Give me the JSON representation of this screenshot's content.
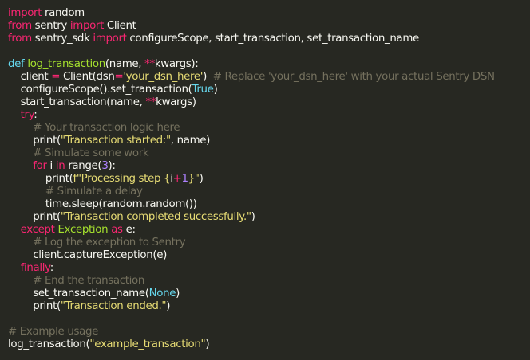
{
  "editor": {
    "colors": {
      "background": "#272822",
      "plain": "#f8f8f2",
      "keyword": "#f92672",
      "definition": "#66d9ef",
      "function": "#a6e22e",
      "string": "#e6db74",
      "number": "#ae81ff",
      "comment": "#75715e"
    },
    "lines": [
      [
        [
          "kw",
          "import"
        ],
        [
          "pl",
          " random"
        ]
      ],
      [
        [
          "kw",
          "from"
        ],
        [
          "pl",
          " sentry "
        ],
        [
          "kw",
          "import"
        ],
        [
          "pl",
          " Client"
        ]
      ],
      [
        [
          "kw",
          "from"
        ],
        [
          "pl",
          " sentry_sdk "
        ],
        [
          "kw",
          "import"
        ],
        [
          "pl",
          " configureScope, start_transaction, set_transaction_name"
        ]
      ],
      [],
      [
        [
          "def",
          "def"
        ],
        [
          "pl",
          " "
        ],
        [
          "fn",
          "log_transaction"
        ],
        [
          "pl",
          "(name, "
        ],
        [
          "op",
          "**"
        ],
        [
          "pl",
          "kwargs):"
        ]
      ],
      [
        [
          "pl",
          "    client "
        ],
        [
          "op",
          "="
        ],
        [
          "pl",
          " Client(dsn"
        ],
        [
          "op",
          "="
        ],
        [
          "str",
          "'your_dsn_here'"
        ],
        [
          "pl",
          ")  "
        ],
        [
          "cm",
          "# Replace 'your_dsn_here' with your actual Sentry DSN"
        ]
      ],
      [
        [
          "pl",
          "    configureScope().set_transaction("
        ],
        [
          "def",
          "True"
        ],
        [
          "pl",
          ")"
        ]
      ],
      [
        [
          "pl",
          "    start_transaction(name, "
        ],
        [
          "op",
          "**"
        ],
        [
          "pl",
          "kwargs)"
        ]
      ],
      [
        [
          "pl",
          "    "
        ],
        [
          "kw",
          "try"
        ],
        [
          "pl",
          ":"
        ]
      ],
      [
        [
          "pl",
          "        "
        ],
        [
          "cm",
          "# Your transaction logic here"
        ]
      ],
      [
        [
          "pl",
          "        print("
        ],
        [
          "str",
          "\"Transaction started:\""
        ],
        [
          "pl",
          ", name)"
        ]
      ],
      [
        [
          "pl",
          "        "
        ],
        [
          "cm",
          "# Simulate some work"
        ]
      ],
      [
        [
          "pl",
          "        "
        ],
        [
          "kw",
          "for"
        ],
        [
          "pl",
          " i "
        ],
        [
          "kw",
          "in"
        ],
        [
          "pl",
          " range("
        ],
        [
          "num",
          "3"
        ],
        [
          "pl",
          "):"
        ]
      ],
      [
        [
          "pl",
          "            print("
        ],
        [
          "str",
          "f\"Processing step {"
        ],
        [
          "pl",
          "i"
        ],
        [
          "op",
          "+"
        ],
        [
          "num",
          "1"
        ],
        [
          "str",
          "}\""
        ],
        [
          "pl",
          ")"
        ]
      ],
      [
        [
          "pl",
          "            "
        ],
        [
          "cm",
          "# Simulate a delay"
        ]
      ],
      [
        [
          "pl",
          "            time.sleep(random.random())"
        ]
      ],
      [
        [
          "pl",
          "        print("
        ],
        [
          "str",
          "\"Transaction completed successfully.\""
        ],
        [
          "pl",
          ")"
        ]
      ],
      [
        [
          "pl",
          "    "
        ],
        [
          "kw",
          "except"
        ],
        [
          "pl",
          " "
        ],
        [
          "fn",
          "Exception"
        ],
        [
          "pl",
          " "
        ],
        [
          "kw",
          "as"
        ],
        [
          "pl",
          " e:"
        ]
      ],
      [
        [
          "pl",
          "        "
        ],
        [
          "cm",
          "# Log the exception to Sentry"
        ]
      ],
      [
        [
          "pl",
          "        client.captureException(e)"
        ]
      ],
      [
        [
          "pl",
          "    "
        ],
        [
          "kw",
          "finally"
        ],
        [
          "pl",
          ":"
        ]
      ],
      [
        [
          "pl",
          "        "
        ],
        [
          "cm",
          "# End the transaction"
        ]
      ],
      [
        [
          "pl",
          "        set_transaction_name("
        ],
        [
          "def",
          "None"
        ],
        [
          "pl",
          ")"
        ]
      ],
      [
        [
          "pl",
          "        print("
        ],
        [
          "str",
          "\"Transaction ended.\""
        ],
        [
          "pl",
          ")"
        ]
      ],
      [],
      [
        [
          "cm",
          "# Example usage"
        ]
      ],
      [
        [
          "pl",
          "log_transaction("
        ],
        [
          "str",
          "\"example_transaction\""
        ],
        [
          "pl",
          ")"
        ]
      ]
    ]
  }
}
